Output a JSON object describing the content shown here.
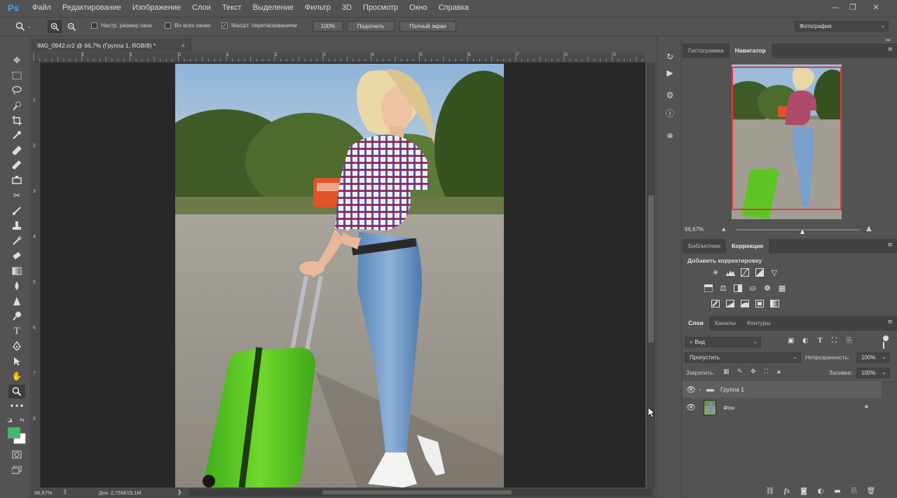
{
  "app": {
    "logo": "Ps"
  },
  "menu": [
    "Файл",
    "Редактирование",
    "Изображение",
    "Слои",
    "Текст",
    "Выделение",
    "Фильтр",
    "3D",
    "Просмотр",
    "Окно",
    "Справка"
  ],
  "window_controls": {
    "minimize": "—",
    "restore": "❐",
    "close": "✕"
  },
  "options": {
    "checks": [
      {
        "label": "Настр. размер окон",
        "checked": false
      },
      {
        "label": "Во всех окнах",
        "checked": false
      },
      {
        "label": "Масшт. перетаскиванием",
        "checked": true
      }
    ],
    "buttons": {
      "zoom100": "100%",
      "fit": "Подогнать",
      "fullscreen": "Полный экран"
    },
    "workspace": "Фотография"
  },
  "document": {
    "tab_title": "IMG_0942.cr2 @ 66,7% (Группа 1, RGB/8) *",
    "close": "×"
  },
  "ruler": {
    "top": [
      "2",
      "1",
      "0",
      "1",
      "2",
      "3",
      "4",
      "5",
      "6",
      "7",
      "8",
      "9"
    ],
    "left": [
      "1",
      "2",
      "3",
      "4",
      "5",
      "6",
      "7",
      "8"
    ]
  },
  "status": {
    "zoom": "66,67%",
    "doc": "Док: 2,75M/19,1M",
    "arrow": "❯"
  },
  "navigator": {
    "tabs": [
      "Гистограмма",
      "Навигатор"
    ],
    "active": 1,
    "zoom": "66,67%",
    "zoom_level": 0.54
  },
  "adjustments": {
    "tabs": [
      "Библиотеки",
      "Коррекция"
    ],
    "active": 1,
    "title": "Добавить корректировку"
  },
  "layers_panel": {
    "tabs": [
      "Слои",
      "Каналы",
      "Контуры"
    ],
    "active": 0,
    "filter": "Вид",
    "blend_mode": "Пропустить",
    "opacity_label": "Непрозрачность:",
    "opacity": "100%",
    "lock_label": "Закрепить:",
    "fill_label": "Заливка:",
    "fill": "100%",
    "layers": [
      {
        "name": "Группа 1",
        "type": "group",
        "visible": true,
        "selected": true
      },
      {
        "name": "Фон",
        "type": "image",
        "visible": true,
        "locked": true
      }
    ],
    "bottom_fx": "fx"
  },
  "colors": {
    "foreground": "#3dba6e",
    "background": "#ffffff",
    "accent": "#31a8ff",
    "nav_frame": "#e03a3a"
  }
}
